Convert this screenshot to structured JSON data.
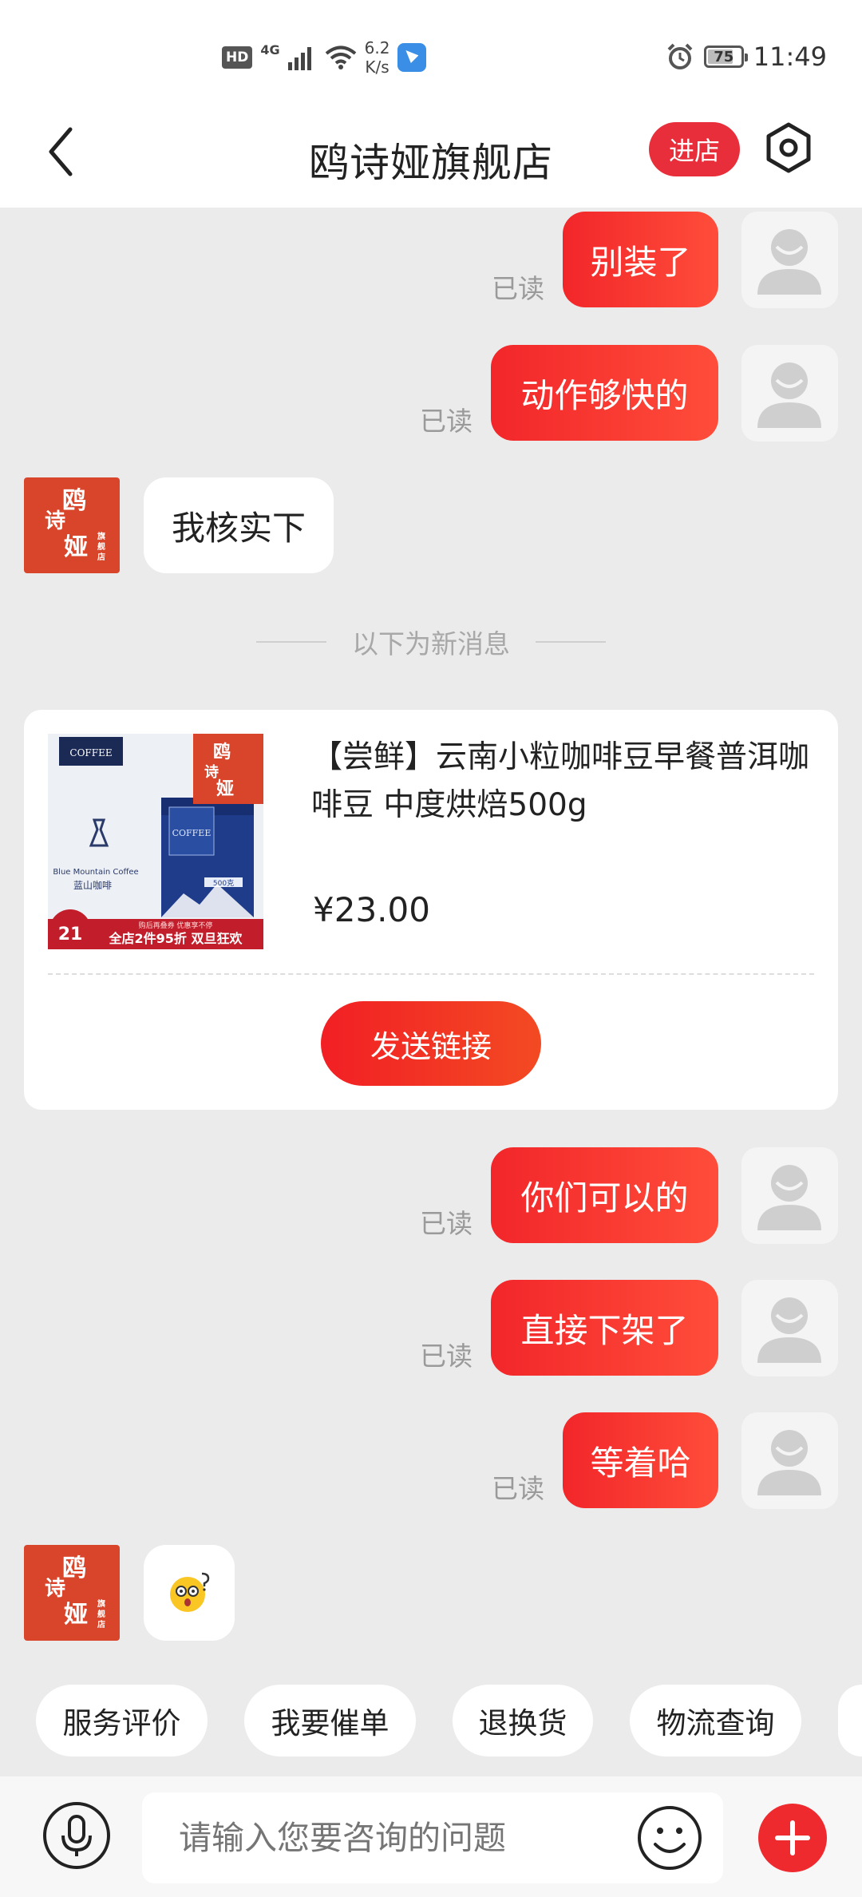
{
  "status_bar": {
    "hd": "HD",
    "network": "4G",
    "speed_value": "6.2",
    "speed_unit": "K/s",
    "battery_level": "75",
    "time": "11:49"
  },
  "header": {
    "title": "鸥诗娅旗舰店",
    "enter_store": "进店"
  },
  "messages": {
    "m1": {
      "text": "别装了",
      "read": "已读"
    },
    "m2": {
      "text": "动作够快的",
      "read": "已读"
    },
    "m3": {
      "text": "我核实下"
    },
    "new_divider": "以下为新消息",
    "m4": {
      "text": "你们可以的",
      "read": "已读"
    },
    "m5": {
      "text": "直接下架了",
      "read": "已读"
    },
    "m6": {
      "text": "等着哈",
      "read": "已读"
    }
  },
  "shop_logo": {
    "c1": "鸥",
    "c2": "诗",
    "c3": "娅",
    "c4": "旗舰店"
  },
  "product": {
    "title": "【尝鲜】云南小粒咖啡豆早餐普洱咖啡豆  中度烘焙500g",
    "price": "¥23.00",
    "send_link": "发送链接",
    "img_brand": "COFFEE",
    "img_caption_en": "Blue Mountain Coffee",
    "img_caption_cn": "蓝山咖啡",
    "img_promo_day": "21",
    "img_promo_top": "购后再叠券 优惠享不停",
    "img_promo_main": "全店2件95折 双旦狂欢",
    "img_bag_weight": "500克"
  },
  "quick_replies": [
    "服务评价",
    "我要催单",
    "退换货",
    "物流查询"
  ],
  "input": {
    "placeholder": "请输入您要咨询的问题"
  }
}
